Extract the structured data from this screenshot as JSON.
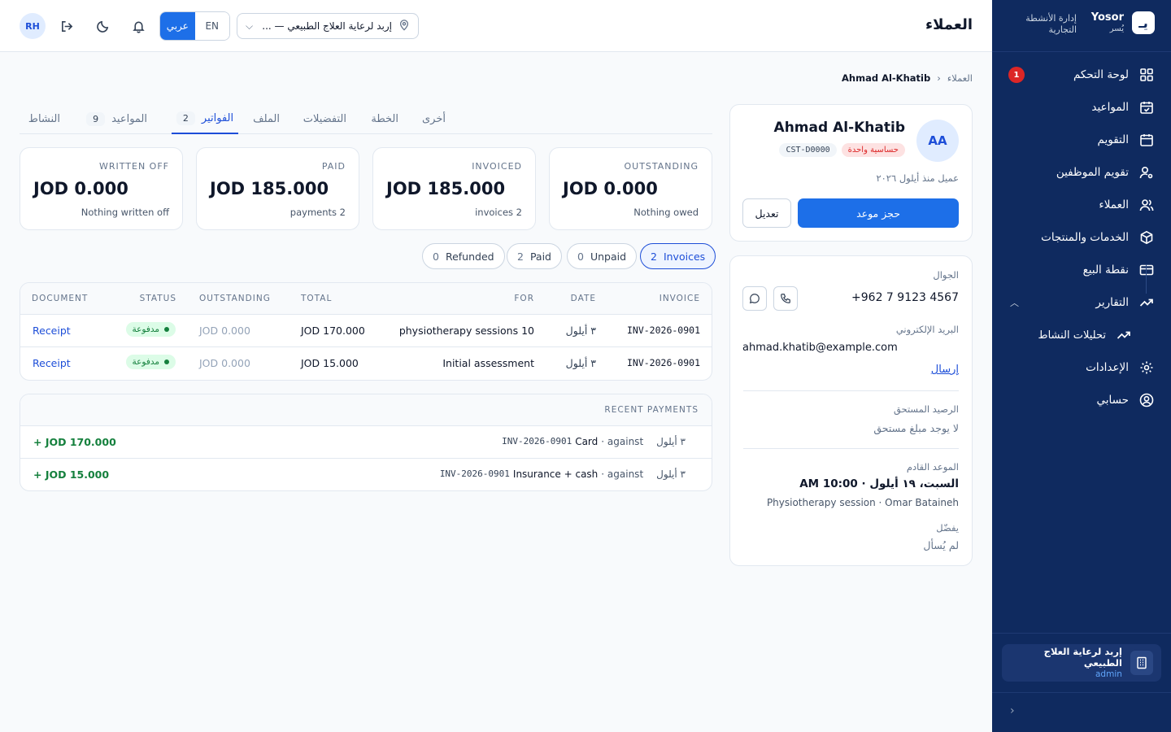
{
  "sidebar": {
    "brand_name": "Yosor",
    "brand_sub": "يُسر",
    "logo_glyph": "يـ",
    "tagline": "إدارة الأنشطة التجارية",
    "items": [
      {
        "label": "لوحة التحكم",
        "icon": "dashboard-grid-icon",
        "badge": "1"
      },
      {
        "label": "المواعيد",
        "icon": "calendar-check-icon"
      },
      {
        "label": "التقويم",
        "icon": "calendar-icon"
      },
      {
        "label": "تقويم الموظفين",
        "icon": "user-cog-icon"
      },
      {
        "label": "العملاء",
        "icon": "users-icon"
      },
      {
        "label": "الخدمات والمنتجات",
        "icon": "box-icon"
      },
      {
        "label": "نقطة البيع",
        "icon": "credit-card-icon"
      },
      {
        "label": "التقارير",
        "icon": "trending-up-icon"
      },
      {
        "label": "تحليلات النشاط",
        "icon": "trending-up-icon"
      },
      {
        "label": "الإعدادات",
        "icon": "gear-icon"
      },
      {
        "label": "حسابي",
        "icon": "user-circle-icon"
      }
    ],
    "org_name": "إربد لرعاية العلاج الطبيعي",
    "org_role": "admin"
  },
  "header": {
    "title": "العملاء",
    "avatar_initials": "RH",
    "lang_active": "عربي",
    "lang_other": "EN",
    "location": "إربد لرعاية العلاج الطبيعي — ..."
  },
  "breadcrumb": {
    "parent": "العملاء",
    "current": "Ahmad Al-Khatib"
  },
  "profile": {
    "initials": "AA",
    "name": "Ahmad Al-Khatib",
    "tag_alert": "حساسية واحدة",
    "customer_id": "CST-D0000",
    "since": "عميل منذ أيلول ٢٠٢٦",
    "book_label": "حجز موعد",
    "edit_label": "تعديل"
  },
  "contact": {
    "phone_label": "الجوال",
    "phone": "+962 7 9123 4567",
    "email_label": "البريد الإلكتروني",
    "email": "ahmad.khatib@example.com",
    "send_label": "إرسال",
    "balance_label": "الرصيد المستحق",
    "balance_value": "لا يوجد مبلغ مستحق",
    "next_label": "الموعد القادم",
    "next_when": "السبت، ١٩ أيلول · 10:00 AM",
    "next_what": "Physiotherapy session · Omar Bataineh",
    "pref_label": "يفضّل",
    "pref_value": "لم يُسأل"
  },
  "tabs": [
    {
      "label": "أخرى"
    },
    {
      "label": "الخطة"
    },
    {
      "label": "التفضيلات"
    },
    {
      "label": "الملف"
    },
    {
      "label": "الفواتير",
      "count": "2"
    },
    {
      "label": "المواعيد",
      "count": "9"
    },
    {
      "label": "النشاط"
    }
  ],
  "stats": [
    {
      "title": "OUTSTANDING",
      "value": "JOD 0.000",
      "sub": "Nothing owed"
    },
    {
      "title": "INVOICED",
      "value": "JOD 185.000",
      "sub": "invoices 2"
    },
    {
      "title": "PAID",
      "value": "JOD 185.000",
      "sub": "payments 2"
    },
    {
      "title": "WRITTEN OFF",
      "value": "JOD 0.000",
      "sub": "Nothing written off"
    }
  ],
  "filters": [
    {
      "label": "Invoices",
      "count": "2"
    },
    {
      "label": "Unpaid",
      "count": "0"
    },
    {
      "label": "Paid",
      "count": "2"
    },
    {
      "label": "Refunded",
      "count": "0"
    }
  ],
  "invoice_table": {
    "headers": {
      "invoice": "INVOICE",
      "date": "DATE",
      "for": "FOR",
      "total": "TOTAL",
      "outstanding": "OUTSTANDING",
      "status": "STATUS",
      "document": "DOCUMENT"
    },
    "rows": [
      {
        "invoice": "INV-2026-0901",
        "date": "٣ أيلول",
        "for": "physiotherapy sessions 10",
        "total": "JOD 170.000",
        "outstanding": "JOD 0.000",
        "status": "مدفوعة",
        "document": "Receipt"
      },
      {
        "invoice": "INV-2026-0901",
        "date": "٣ أيلول",
        "for": "Initial assessment",
        "total": "JOD 15.000",
        "outstanding": "JOD 0.000",
        "status": "مدفوعة",
        "document": "Receipt"
      }
    ]
  },
  "payments": {
    "title": "RECENT PAYMENTS",
    "rows": [
      {
        "date": "٣ أيلول",
        "against": "against ·",
        "invoice": "INV-2026-0901",
        "method": "Card",
        "amount": "+ JOD 170.000"
      },
      {
        "date": "٣ أيلول",
        "against": "against ·",
        "invoice": "INV-2026-0901",
        "method": "Insurance + cash",
        "amount": "+ JOD 15.000"
      }
    ]
  },
  "colors": {
    "sidebar": "#0f2a5f",
    "accent": "#1d6fe8",
    "paid": "#15803d",
    "alert": "#dc2626"
  }
}
